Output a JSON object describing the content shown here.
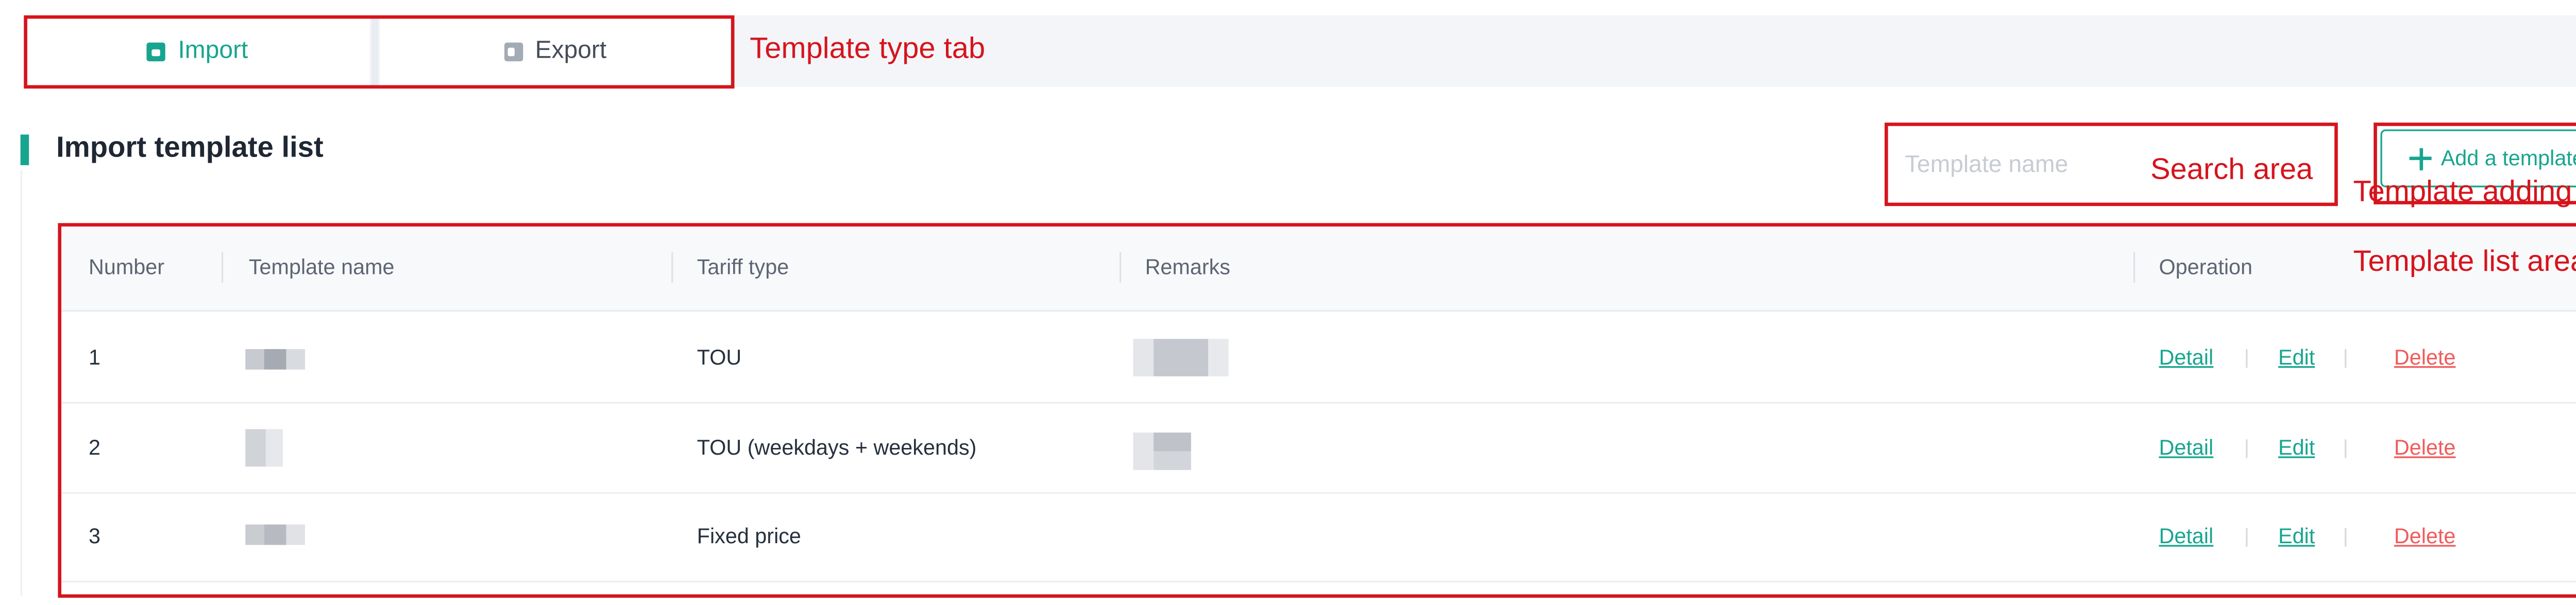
{
  "tabs": [
    {
      "label": "Import",
      "active": true,
      "icon": "import-icon"
    },
    {
      "label": "Export",
      "active": false,
      "icon": "export-icon"
    }
  ],
  "section": {
    "title": "Import template list"
  },
  "search": {
    "placeholder": "Template name",
    "value": ""
  },
  "toolbar": {
    "add_label": "Add a template",
    "add_icon": "plus-icon"
  },
  "table": {
    "columns": [
      "Number",
      "Template name",
      "Tariff type",
      "Remarks",
      "Operation"
    ],
    "rows": [
      {
        "number": "1",
        "tariff_type": "TOU"
      },
      {
        "number": "2",
        "tariff_type": "TOU (weekdays + weekends)"
      },
      {
        "number": "3",
        "tariff_type": "Fixed price"
      }
    ],
    "operations": {
      "detail": "Detail",
      "edit": "Edit",
      "delete": "Delete"
    }
  },
  "annotations": {
    "tabs": "Template type tab",
    "search": "Search area",
    "add": "Template adding area",
    "list": "Template list area"
  },
  "colors": {
    "accent": "#17a58f",
    "danger": "#f05b5b",
    "annotation": "#d6141c"
  }
}
